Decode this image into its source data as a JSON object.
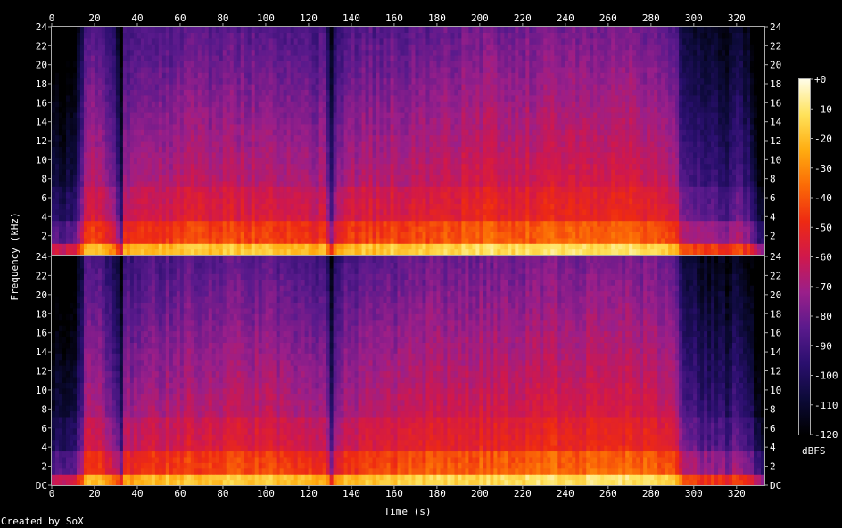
{
  "chart_data": {
    "type": "heatmap",
    "title": "",
    "xlabel": "Time (s)",
    "ylabel": "Frequency (kHz)",
    "xlim": [
      0,
      333
    ],
    "ylim": [
      0,
      24
    ],
    "x_ticks": [
      "0",
      "20",
      "40",
      "60",
      "80",
      "100",
      "120",
      "140",
      "160",
      "180",
      "200",
      "220",
      "240",
      "260",
      "280",
      "300",
      "320"
    ],
    "x_tick_values": [
      0,
      20,
      40,
      60,
      80,
      100,
      120,
      140,
      160,
      180,
      200,
      220,
      240,
      260,
      280,
      300,
      320
    ],
    "y_ticks_top": [
      "2",
      "4",
      "6",
      "8",
      "10",
      "12",
      "14",
      "16",
      "18",
      "20",
      "22",
      "24"
    ],
    "y_ticks_bottom": [
      "DC",
      "2",
      "4",
      "6",
      "8",
      "10",
      "12",
      "14",
      "16",
      "18",
      "20",
      "22",
      "24"
    ],
    "y_tick_values_top": [
      2,
      4,
      6,
      8,
      10,
      12,
      14,
      16,
      18,
      20,
      22,
      24
    ],
    "y_tick_values_bottom": [
      0,
      2,
      4,
      6,
      8,
      10,
      12,
      14,
      16,
      18,
      20,
      22,
      24
    ],
    "channels": 2,
    "colorbar": {
      "label": "dBFS",
      "range": [
        -120,
        0
      ],
      "ticks": [
        "+0",
        "-10",
        "-20",
        "-30",
        "-40",
        "-50",
        "-60",
        "-70",
        "-80",
        "-90",
        "-100",
        "-110",
        "-120"
      ],
      "tick_values": [
        0,
        -10,
        -20,
        -30,
        -40,
        -50,
        -60,
        -70,
        -80,
        -90,
        -100,
        -110,
        -120
      ]
    },
    "footer": "Created by SoX",
    "colors": {
      "background": "#000000",
      "text": "#ffffff",
      "axis": "#aaaaaa",
      "palette": [
        "#000000",
        "#0c0a38",
        "#2a0f6e",
        "#5a1a8c",
        "#9a1f8a",
        "#d0184c",
        "#ee2a12",
        "#fb6a06",
        "#ffac10",
        "#ffe25a",
        "#fffde8"
      ]
    },
    "level_profile_time": [
      [
        0,
        -98
      ],
      [
        5,
        -98
      ],
      [
        10,
        -96
      ],
      [
        14,
        -78
      ],
      [
        16,
        -55
      ],
      [
        22,
        -58
      ],
      [
        26,
        -68
      ],
      [
        30,
        -72
      ],
      [
        33,
        -95
      ],
      [
        34,
        -62
      ],
      [
        40,
        -60
      ],
      [
        60,
        -56
      ],
      [
        80,
        -55
      ],
      [
        100,
        -55
      ],
      [
        120,
        -58
      ],
      [
        128,
        -60
      ],
      [
        131,
        -88
      ],
      [
        133,
        -62
      ],
      [
        140,
        -58
      ],
      [
        160,
        -55
      ],
      [
        180,
        -52
      ],
      [
        200,
        -50
      ],
      [
        220,
        -50
      ],
      [
        240,
        -49
      ],
      [
        260,
        -48
      ],
      [
        280,
        -50
      ],
      [
        292,
        -55
      ],
      [
        295,
        -80
      ],
      [
        300,
        -82
      ],
      [
        310,
        -85
      ],
      [
        316,
        -88
      ],
      [
        320,
        -80
      ],
      [
        325,
        -85
      ],
      [
        330,
        -105
      ],
      [
        333,
        -110
      ]
    ]
  }
}
